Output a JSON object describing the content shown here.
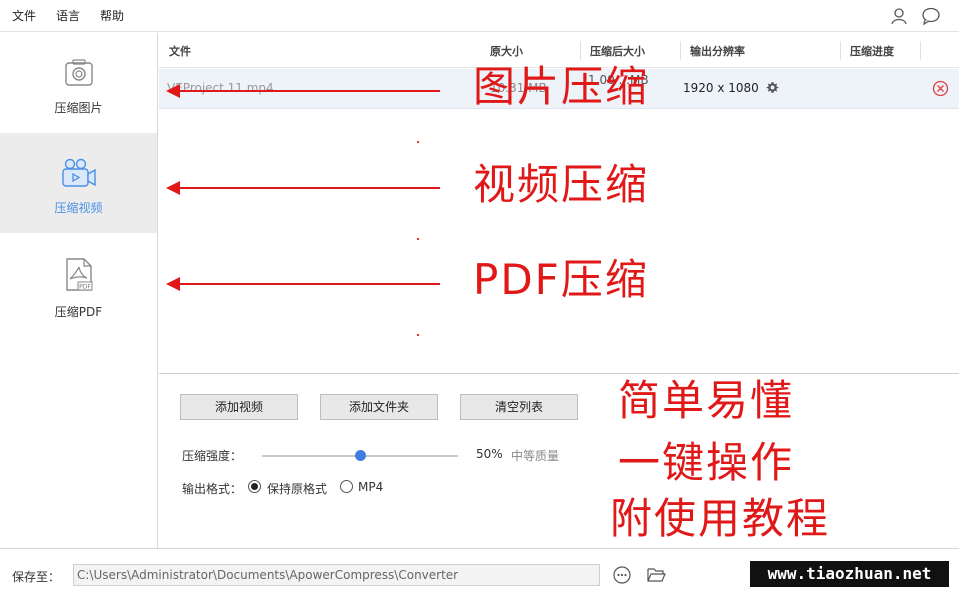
{
  "menu": {
    "file": "文件",
    "language": "语言",
    "help": "帮助"
  },
  "topbar_icons": {
    "user": "user-icon",
    "feedback": "chat-bubble-icon"
  },
  "sidebar": {
    "items": [
      {
        "label": "压缩图片",
        "icon": "image-compress-icon",
        "active": false
      },
      {
        "label": "压缩视频",
        "icon": "video-camera-icon",
        "active": true
      },
      {
        "label": "压缩PDF",
        "icon": "pdf-file-icon",
        "active": false
      }
    ]
  },
  "table": {
    "headers": [
      "文件",
      "原大小",
      "压缩后大小",
      "输出分辨率",
      "压缩进度"
    ],
    "rows": [
      {
        "file": "VEProject 11.mp4",
        "size": "10.31 MB",
        "compressed": "1.00 ...MB",
        "resolution": "1920 x 1080"
      }
    ]
  },
  "controls": {
    "add_video": "添加视频",
    "add_folder": "添加文件夹",
    "clear_list": "清空列表",
    "strength_label": "压缩强度：",
    "strength_value": "50%",
    "strength_fraction": 0.5,
    "quality_label": "中等质量",
    "format_label": "输出格式：",
    "format_keep": "保持原格式",
    "format_mp4": "MP4"
  },
  "footer": {
    "save_label": "保存至：",
    "save_path": "C:\\Users\\Administrator\\Documents\\ApowerCompress\\Converter",
    "watermark": "www.tiaozhuan.net"
  },
  "annotations": {
    "image": "图片压缩",
    "video": "视频压缩",
    "pdf": "PDF压缩",
    "easy": "简单易懂",
    "one_click": "一键操作",
    "tutorial": "附使用教程"
  },
  "colors": {
    "accent": "#4a90e2",
    "annotation": "#e11818",
    "row_bg": "#eef3f9"
  }
}
